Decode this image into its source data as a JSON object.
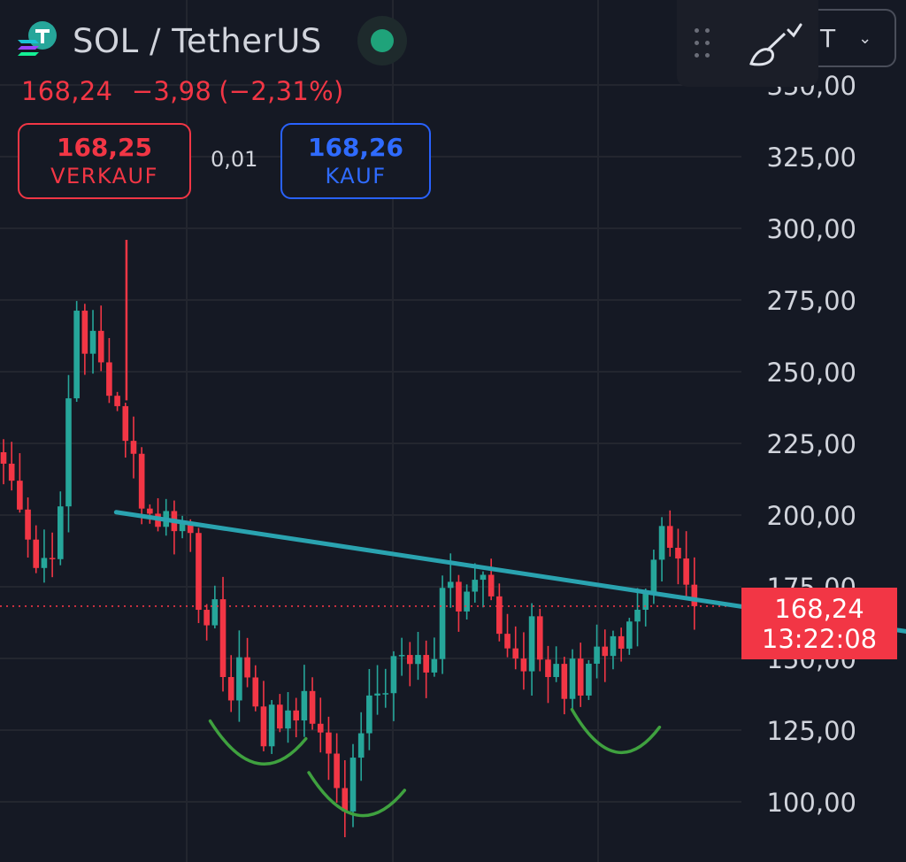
{
  "header": {
    "symbol": "SOL / TetherUS",
    "logo_icon": "solana-tether-icon",
    "status_color": "#1fa37a"
  },
  "quote": {
    "last": "168,24",
    "change": "−3,98",
    "change_pct": "(−2,31%)"
  },
  "trade": {
    "sell_price": "168,25",
    "sell_label": "VERKAUF",
    "spread": "0,01",
    "buy_price": "168,26",
    "buy_label": "KAUF"
  },
  "toolbar": {
    "grip_icon": "drag-handle-icon",
    "brush_icon": "brush-icon",
    "interval_label": "T"
  },
  "last_label": {
    "price": "168,24",
    "countdown": "13:22:08"
  },
  "colors": {
    "up": "#26a69a",
    "down": "#f23645",
    "trendline": "#2aa3b0",
    "annotation": "#3fa13f",
    "grid": "#23262f"
  },
  "chart_data": {
    "type": "candlestick",
    "title": "",
    "xlabel": "",
    "ylabel": "",
    "ylim": [
      88,
      350
    ],
    "y_ticks": [
      {
        "value": 350,
        "label": "350,00"
      },
      {
        "value": 325,
        "label": "325,00"
      },
      {
        "value": 300,
        "label": "300,00"
      },
      {
        "value": 275,
        "label": "275,00"
      },
      {
        "value": 250,
        "label": "250,00"
      },
      {
        "value": 225,
        "label": "225,00"
      },
      {
        "value": 200,
        "label": "200,00"
      },
      {
        "value": 175,
        "label": "175,00"
      },
      {
        "value": 150,
        "label": "150,00"
      },
      {
        "value": 125,
        "label": "125,00"
      },
      {
        "value": 100,
        "label": "100,00"
      }
    ],
    "last_price": 168.24,
    "close_path": [
      [
        0,
        218
      ],
      [
        2,
        205
      ],
      [
        4,
        182
      ],
      [
        6,
        188
      ],
      [
        7,
        200
      ],
      [
        8,
        240
      ],
      [
        9,
        272
      ],
      [
        10,
        258
      ],
      [
        11,
        262
      ],
      [
        12,
        252
      ],
      [
        13,
        245
      ],
      [
        14,
        238
      ],
      [
        15,
        228
      ],
      [
        16,
        220
      ],
      [
        17,
        205
      ],
      [
        18,
        200
      ],
      [
        19,
        196
      ],
      [
        20,
        204
      ],
      [
        21,
        198
      ],
      [
        22,
        194
      ],
      [
        23,
        190
      ],
      [
        24,
        170
      ],
      [
        25,
        162
      ],
      [
        26,
        167
      ],
      [
        27,
        146
      ],
      [
        28,
        136
      ],
      [
        29,
        150
      ],
      [
        30,
        142
      ],
      [
        31,
        135
      ],
      [
        32,
        122
      ],
      [
        33,
        130
      ],
      [
        34,
        126
      ],
      [
        35,
        134
      ],
      [
        36,
        128
      ],
      [
        37,
        140
      ],
      [
        38,
        130
      ],
      [
        39,
        122
      ],
      [
        40,
        118
      ],
      [
        41,
        106
      ],
      [
        42,
        100
      ],
      [
        43,
        112
      ],
      [
        44,
        126
      ],
      [
        45,
        134
      ],
      [
        46,
        138
      ],
      [
        47,
        140
      ],
      [
        48,
        150
      ],
      [
        49,
        152
      ],
      [
        50,
        146
      ],
      [
        51,
        150
      ],
      [
        52,
        148
      ],
      [
        53,
        152
      ],
      [
        54,
        175
      ],
      [
        55,
        180
      ],
      [
        56,
        170
      ],
      [
        57,
        174
      ],
      [
        58,
        176
      ],
      [
        59,
        178
      ],
      [
        60,
        168
      ],
      [
        61,
        160
      ],
      [
        62,
        154
      ],
      [
        63,
        150
      ],
      [
        64,
        146
      ],
      [
        65,
        162
      ],
      [
        66,
        150
      ],
      [
        67,
        144
      ],
      [
        68,
        150
      ],
      [
        69,
        138
      ],
      [
        70,
        148
      ],
      [
        71,
        140
      ],
      [
        72,
        150
      ],
      [
        73,
        152
      ],
      [
        74,
        148
      ],
      [
        75,
        154
      ],
      [
        76,
        150
      ],
      [
        77,
        160
      ],
      [
        78,
        165
      ],
      [
        79,
        172
      ],
      [
        80,
        184
      ],
      [
        81,
        200
      ],
      [
        82,
        190
      ],
      [
        83,
        186
      ],
      [
        84,
        178
      ],
      [
        85,
        168.24
      ]
    ],
    "peak_wick": [
      10,
      296
    ],
    "series_count_hint": 85,
    "trendline": {
      "from": [
        18,
        201
      ],
      "to": [
        102,
        165
      ]
    },
    "annotations": [
      {
        "type": "arc",
        "x": [
          29,
          40
        ],
        "low": 114
      },
      {
        "type": "arc",
        "x": [
          41,
          52
        ],
        "low": 96
      },
      {
        "type": "arc",
        "x": [
          73,
          83
        ],
        "low": 118
      }
    ]
  }
}
